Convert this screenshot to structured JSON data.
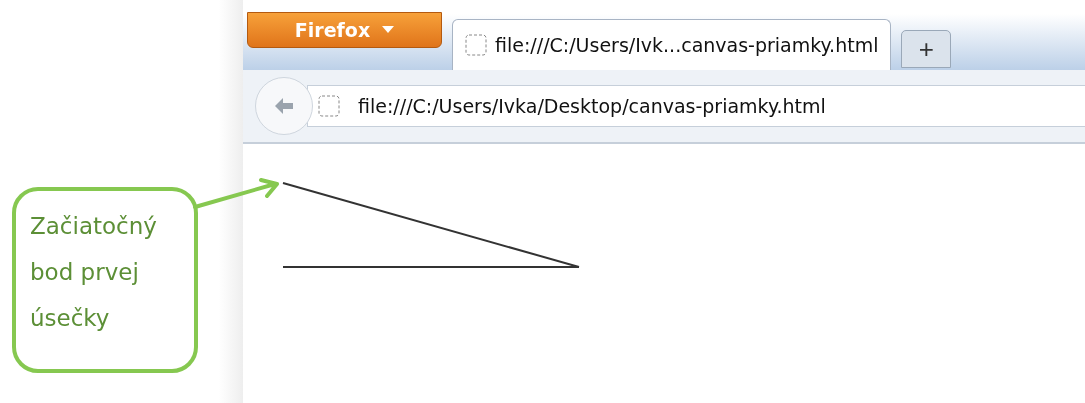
{
  "callout": {
    "text": "Začiatočný bod prvej úsečky"
  },
  "browser": {
    "menu_button": "Firefox",
    "tabs": [
      {
        "label": "file:///C:/Users/Ivk...canvas-priamky.html",
        "selected": true
      }
    ],
    "new_tab": "+",
    "address_bar": {
      "value": "file:///C:/Users/Ivka/Desktop/canvas-priamky.html"
    }
  }
}
